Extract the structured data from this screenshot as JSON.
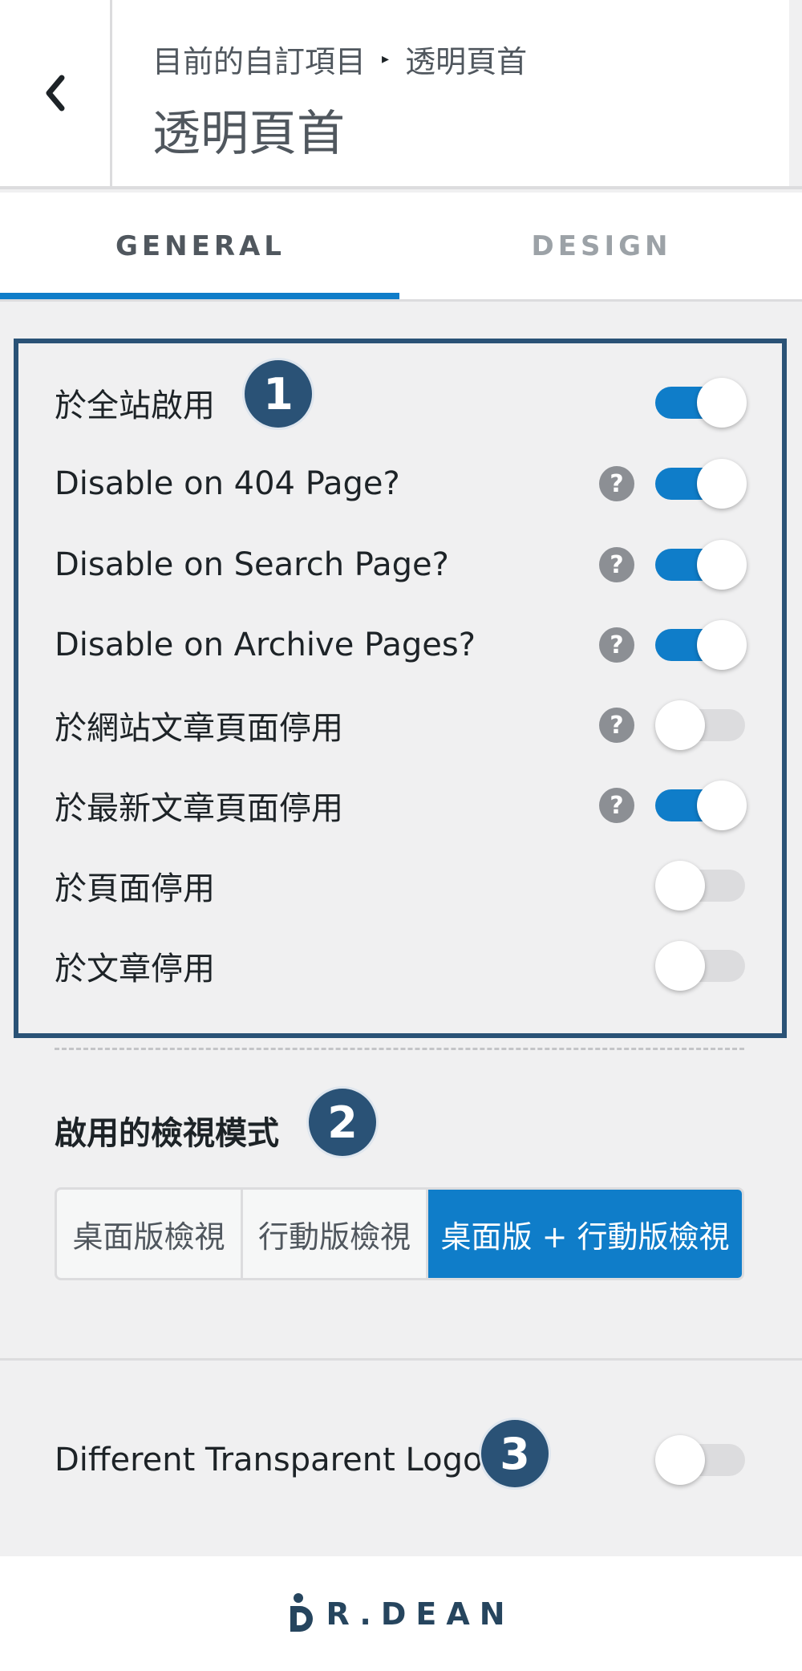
{
  "header": {
    "breadcrumb_parent": "目前的自訂項目",
    "breadcrumb_separator": "▸",
    "breadcrumb_current": "透明頁首",
    "title": "透明頁首",
    "back_icon": "chevron-left-icon"
  },
  "tabs": [
    {
      "label": "GENERAL",
      "active": true
    },
    {
      "label": "DESIGN",
      "active": false
    }
  ],
  "settings": [
    {
      "label": "於全站啟用",
      "help": false,
      "enabled": true
    },
    {
      "label": "Disable on 404 Page?",
      "help": true,
      "enabled": true
    },
    {
      "label": "Disable on Search Page?",
      "help": true,
      "enabled": true
    },
    {
      "label": "Disable on Archive Pages?",
      "help": true,
      "enabled": true
    },
    {
      "label": "於網站文章頁面停用",
      "help": true,
      "enabled": false
    },
    {
      "label": "於最新文章頁面停用",
      "help": true,
      "enabled": true
    },
    {
      "label": "於頁面停用",
      "help": false,
      "enabled": false
    },
    {
      "label": "於文章停用",
      "help": false,
      "enabled": false
    }
  ],
  "help_glyph": "?",
  "view_mode": {
    "title": "啟用的檢視模式",
    "options": [
      "桌面版檢視",
      "行動版檢視",
      "桌面版 + 行動版檢視"
    ],
    "selected": "桌面版 + 行動版檢視"
  },
  "logo_toggle": {
    "label": "Different Transparent Logo",
    "enabled": false
  },
  "badges": [
    "1",
    "2",
    "3"
  ],
  "footer": {
    "logo_text": "R.DEAN"
  },
  "colors": {
    "accent": "#0f7dc9",
    "badge": "#2a5276",
    "toggle_off": "#dcdcde"
  }
}
